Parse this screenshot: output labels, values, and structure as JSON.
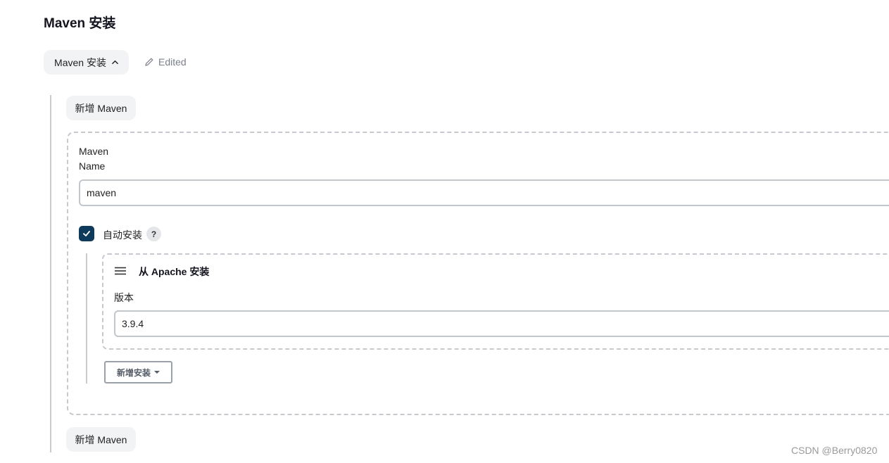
{
  "section": {
    "title": "Maven 安装"
  },
  "toggle": {
    "label": "Maven 安装",
    "expanded_icon": "chevron-up-icon"
  },
  "status": {
    "edited_label": "Edited",
    "icon": "pencil-icon"
  },
  "add_maven": {
    "top_label": "新增 Maven",
    "bottom_label": "新增 Maven"
  },
  "maven": {
    "name_label_line1": "Maven",
    "name_label_line2": "Name",
    "name_value": "maven",
    "auto_install_label": "自动安装",
    "auto_install_checked": true,
    "help_glyph": "?"
  },
  "installer": {
    "title": "从 Apache 安装",
    "version_label": "版本",
    "version_value": "3.9.4",
    "add_installer_label": "新增安装"
  },
  "watermark": "CSDN @Berry0820",
  "colors": {
    "accent": "#0e3a5c",
    "panel_bg": "#f2f3f5",
    "border": "#c2c7cc",
    "muted_text": "#7a7f8a"
  }
}
